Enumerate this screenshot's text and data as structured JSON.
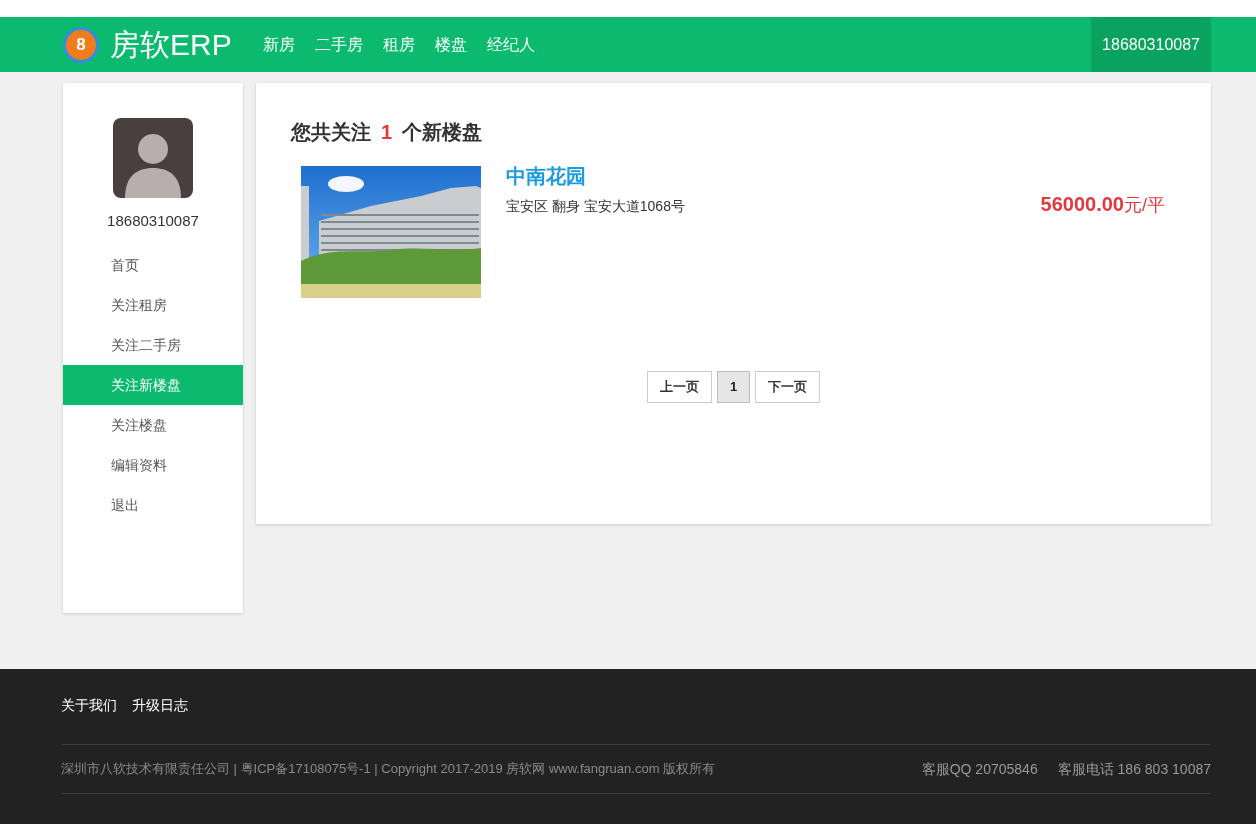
{
  "navbar": {
    "brand_badge": "8",
    "brand_title": "房软ERP",
    "links": [
      {
        "label": "新房",
        "selected": false
      },
      {
        "label": "二手房",
        "selected": false
      },
      {
        "label": "租房",
        "selected": false
      },
      {
        "label": "楼盘",
        "selected": false
      },
      {
        "label": "经纪人",
        "selected": false
      }
    ],
    "account": "18680310087"
  },
  "sidebar": {
    "phone": "18680310087",
    "items": [
      {
        "label": "首页",
        "selected": false
      },
      {
        "label": "关注租房",
        "selected": false
      },
      {
        "label": "关注二手房",
        "selected": false
      },
      {
        "label": "关注新楼盘",
        "selected": true
      },
      {
        "label": "关注楼盘",
        "selected": false
      },
      {
        "label": "编辑资料",
        "selected": false
      },
      {
        "label": "退出",
        "selected": false
      }
    ]
  },
  "heading": {
    "prefix": "您共关注",
    "count": "1",
    "suffix": "个新楼盘"
  },
  "listings": [
    {
      "name": "中南花园",
      "address": "宝安区 翻身 宝安大道1068号",
      "price": "**56000.00**元/平"
    }
  ],
  "pagination": {
    "prev": "上一页",
    "pages": [
      {
        "label": "1",
        "selected": true
      }
    ],
    "next": "下一页"
  },
  "footer": {
    "links": [
      "关于我们",
      "升级日志"
    ],
    "copyright": "深圳市八软技术有限责任公司 | 粤ICP备17108075号-1 | Copyright 2017-2019 房软网 www.fangruan.com 版权所有",
    "contacts": [
      "客服QQ 20705846",
      "客服电话 186 803 10087"
    ]
  }
}
